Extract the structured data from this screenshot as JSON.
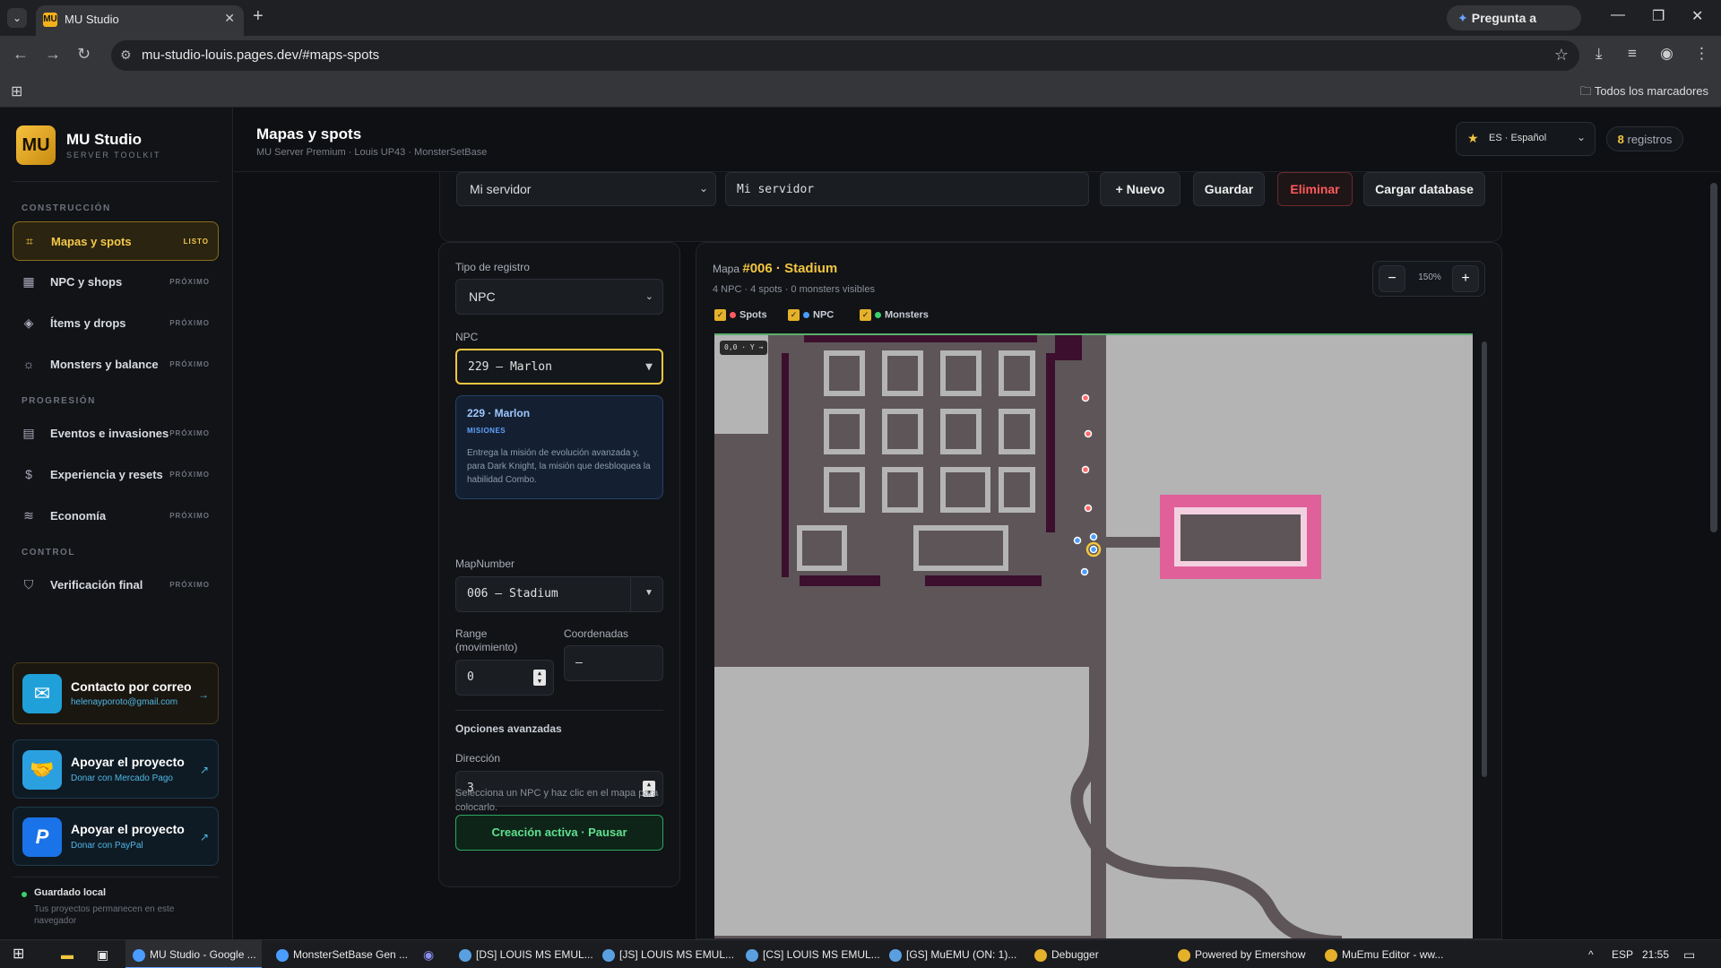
{
  "browser": {
    "tab_title": "MU Studio",
    "tab_favicon": "MU",
    "gemini_label": "Pregunta a Gemini",
    "url": "mu-studio-louis.pages.dev/#maps-spots",
    "bookmarks_label": "Todos los marcadores"
  },
  "sidebar": {
    "logo_text": "MU",
    "app_name": "MU Studio",
    "app_tagline": "SERVER TOOLKIT",
    "sections": {
      "construccion": "CONSTRUCCIÓN",
      "progresion": "PROGRESIÓN",
      "control": "CONTROL"
    },
    "items": [
      {
        "label": "Mapas y spots",
        "badge": "LISTO",
        "icon": "map-icon"
      },
      {
        "label": "NPC y shops",
        "badge": "PRÓXIMO",
        "icon": "shop-icon"
      },
      {
        "label": "Ítems y drops",
        "badge": "PRÓXIMO",
        "icon": "layers-icon"
      },
      {
        "label": "Monsters y balance",
        "badge": "PRÓXIMO",
        "icon": "monster-icon"
      },
      {
        "label": "Eventos e invasiones",
        "badge": "PRÓXIMO",
        "icon": "calendar-icon"
      },
      {
        "label": "Experiencia y resets",
        "badge": "PRÓXIMO",
        "icon": "dollar-icon"
      },
      {
        "label": "Economía",
        "badge": "PRÓXIMO",
        "icon": "database-icon"
      },
      {
        "label": "Verificación final",
        "badge": "PRÓXIMO",
        "icon": "shield-check-icon"
      }
    ],
    "contact": {
      "title": "Contacto por correo",
      "email": "helenayporoto@gmail.com"
    },
    "support_mp": {
      "title": "Apoyar el proyecto",
      "sub": "Donar con Mercado Pago"
    },
    "support_pp": {
      "title": "Apoyar el proyecto",
      "sub": "Donar con PayPal"
    },
    "saved": {
      "title": "Guardado local",
      "sub": "Tus proyectos permanecen en este navegador"
    }
  },
  "header": {
    "title": "Mapas y spots",
    "subtitle": "MU Server Premium · Louis UP43 · MonsterSetBase",
    "language": "ES · Español",
    "records_count": "8",
    "records_label": "registros"
  },
  "toolbar": {
    "server_select": "Mi servidor",
    "server_name": "Mi servidor",
    "new_label": "+ Nuevo",
    "save_label": "Guardar",
    "delete_label": "Eliminar",
    "load_label": "Cargar database"
  },
  "form": {
    "record_type_label": "Tipo de registro",
    "record_type_value": "NPC",
    "npc_label": "NPC",
    "npc_value": "229 — Marlon",
    "npc_card": {
      "title": "229 · Marlon",
      "tag": "MISIONES",
      "desc": "Entrega la misión de evolución avanzada y, para Dark Knight, la misión que desbloquea la habilidad Combo."
    },
    "map_label": "MapNumber",
    "map_value": "006 — Stadium",
    "range_label": "Range (movimiento)",
    "range_value": "0",
    "coords_label": "Coordenadas",
    "coords_value": "—",
    "advanced_label": "Opciones avanzadas",
    "direction_label": "Dirección",
    "direction_value": "3",
    "help": "Selecciona un NPC y haz clic en el mapa para colocarlo.",
    "create_btn": "Creación activa · Pausar"
  },
  "map": {
    "prefix": "Mapa",
    "name": "#006 · Stadium",
    "stats": "4 NPC · 4 spots · 0 monsters visibles",
    "zoom": "150%",
    "coord_tag": "0,0 · Y →",
    "legend": {
      "spots": "Spots",
      "npc": "NPC",
      "monsters": "Monsters"
    },
    "colors": {
      "spots": "#ff5a5f",
      "npc": "#4a9dff",
      "monsters": "#38d16a"
    }
  },
  "taskbar": {
    "apps": [
      "MU Studio - Google ...",
      "MonsterSetBase Gen ...",
      "[DS] LOUIS MS EMUL...",
      "[JS] LOUIS MS EMUL...",
      "[CS] LOUIS MS EMUL...",
      "[GS] MuEMU (ON: 1)...",
      "Debugger",
      "Powered by Emershow",
      "MuEmu Editor - ww..."
    ],
    "lang": "ESP",
    "time": "21:55"
  }
}
